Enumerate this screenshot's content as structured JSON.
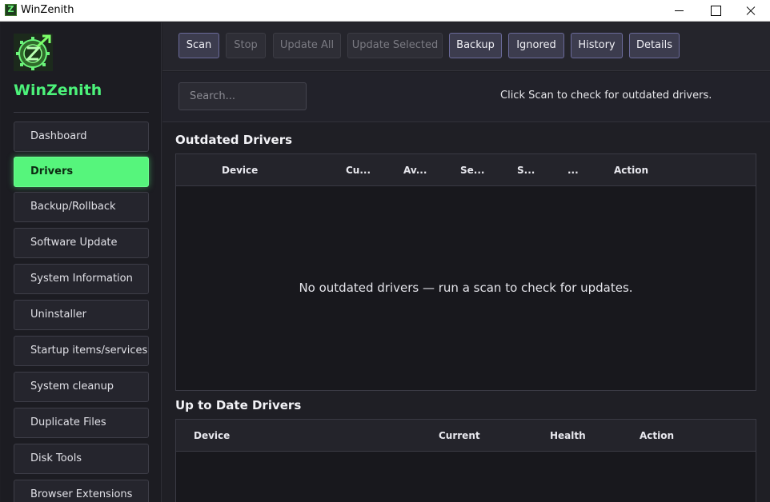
{
  "window": {
    "title": "WinZenith",
    "min_label": "",
    "max_label": "",
    "close_label": ""
  },
  "sidebar": {
    "brand": "WinZenith",
    "items": [
      {
        "label": "Dashboard",
        "active": false
      },
      {
        "label": "Drivers",
        "active": true
      },
      {
        "label": "Backup/Rollback",
        "active": false
      },
      {
        "label": "Software Update",
        "active": false
      },
      {
        "label": "System Information",
        "active": false
      },
      {
        "label": "Uninstaller",
        "active": false
      },
      {
        "label": "Startup items/services",
        "active": false
      },
      {
        "label": "System cleanup",
        "active": false
      },
      {
        "label": "Duplicate Files",
        "active": false
      },
      {
        "label": "Disk Tools",
        "active": false
      },
      {
        "label": "Browser Extensions",
        "active": false
      }
    ]
  },
  "toolbar": {
    "buttons": [
      {
        "label": "Scan",
        "enabled": true
      },
      {
        "label": "Stop",
        "enabled": false
      },
      {
        "label": "Update All",
        "enabled": false
      },
      {
        "label": "Update Selected",
        "enabled": false
      },
      {
        "label": "Backup",
        "enabled": true
      },
      {
        "label": "Ignored",
        "enabled": true
      },
      {
        "label": "History",
        "enabled": true
      },
      {
        "label": "Details",
        "enabled": true
      }
    ]
  },
  "search": {
    "placeholder": "Search...",
    "value": ""
  },
  "status_text": "Click Scan to check for outdated drivers.",
  "outdated": {
    "title": "Outdated Drivers",
    "columns": [
      "Device",
      "Cu...",
      "Av...",
      "Se...",
      "S...",
      "...",
      "Action"
    ],
    "empty_message": "No outdated drivers — run a scan to check for updates."
  },
  "uptodate": {
    "title": "Up to Date Drivers",
    "columns": [
      "Device",
      "Current",
      "Health",
      "Action"
    ]
  },
  "colors": {
    "accent": "#56f57c",
    "brand": "#4cf27a",
    "background": "#1e1e24"
  }
}
